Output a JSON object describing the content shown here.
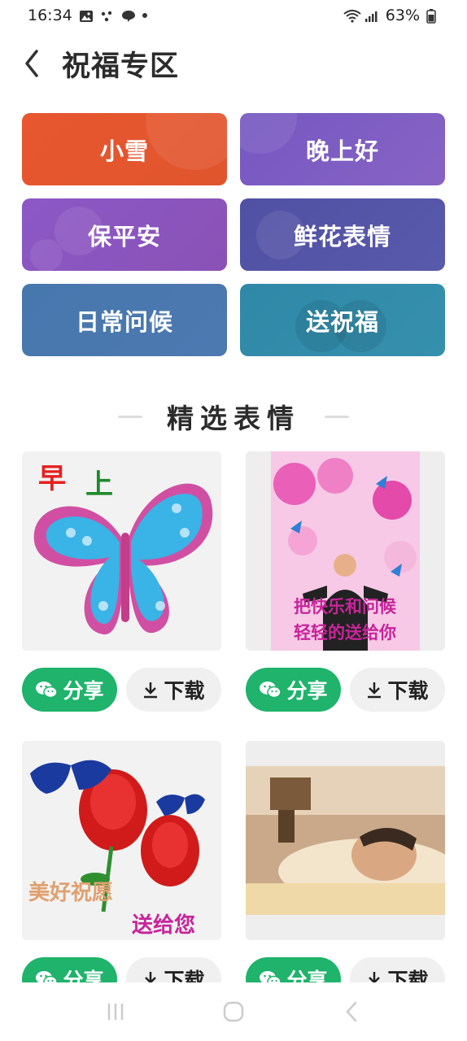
{
  "status_bar": {
    "time": "16:34",
    "battery": "63%",
    "icons": [
      "gallery-icon",
      "dots-icon",
      "chat-bubble-icon",
      "dot-icon",
      "wifi-icon",
      "signal-icon",
      "battery-icon"
    ]
  },
  "header": {
    "title": "祝福专区",
    "back_icon": "chevron-left-icon"
  },
  "categories": [
    {
      "label": "小雪",
      "color": "#e4562f"
    },
    {
      "label": "晚上好",
      "color": "#7d5cc0"
    },
    {
      "label": "保平安",
      "color": "#8a55bb"
    },
    {
      "label": "鲜花表情",
      "color": "#5a54a8"
    },
    {
      "label": "日常问候",
      "color": "#4a77ad"
    },
    {
      "label": "送祝福",
      "color": "#3189a8"
    }
  ],
  "section": {
    "title": "精选表情"
  },
  "cards": [
    {
      "image": "butterfly-morning-gif",
      "image_text": [
        "早",
        "上"
      ],
      "share_label": "分享",
      "download_label": "下载"
    },
    {
      "image": "man-with-butterflies-gif",
      "image_text": [
        "把快乐和问候",
        "轻轻的送给你"
      ],
      "share_label": "分享",
      "download_label": "下载"
    },
    {
      "image": "roses-butterflies-gif",
      "image_text": [
        "美好祝愿",
        "送给您"
      ],
      "share_label": "分享",
      "download_label": "下载"
    },
    {
      "image": "sleeping-person-gif",
      "image_text": [],
      "share_label": "分享",
      "download_label": "下载"
    }
  ],
  "colors": {
    "share_green": "#1fb36b",
    "download_gray": "#f0f0f0",
    "card_bg": "#eeeeee"
  },
  "nav": {
    "icons": [
      "recent-apps-icon",
      "home-icon",
      "back-icon"
    ]
  }
}
